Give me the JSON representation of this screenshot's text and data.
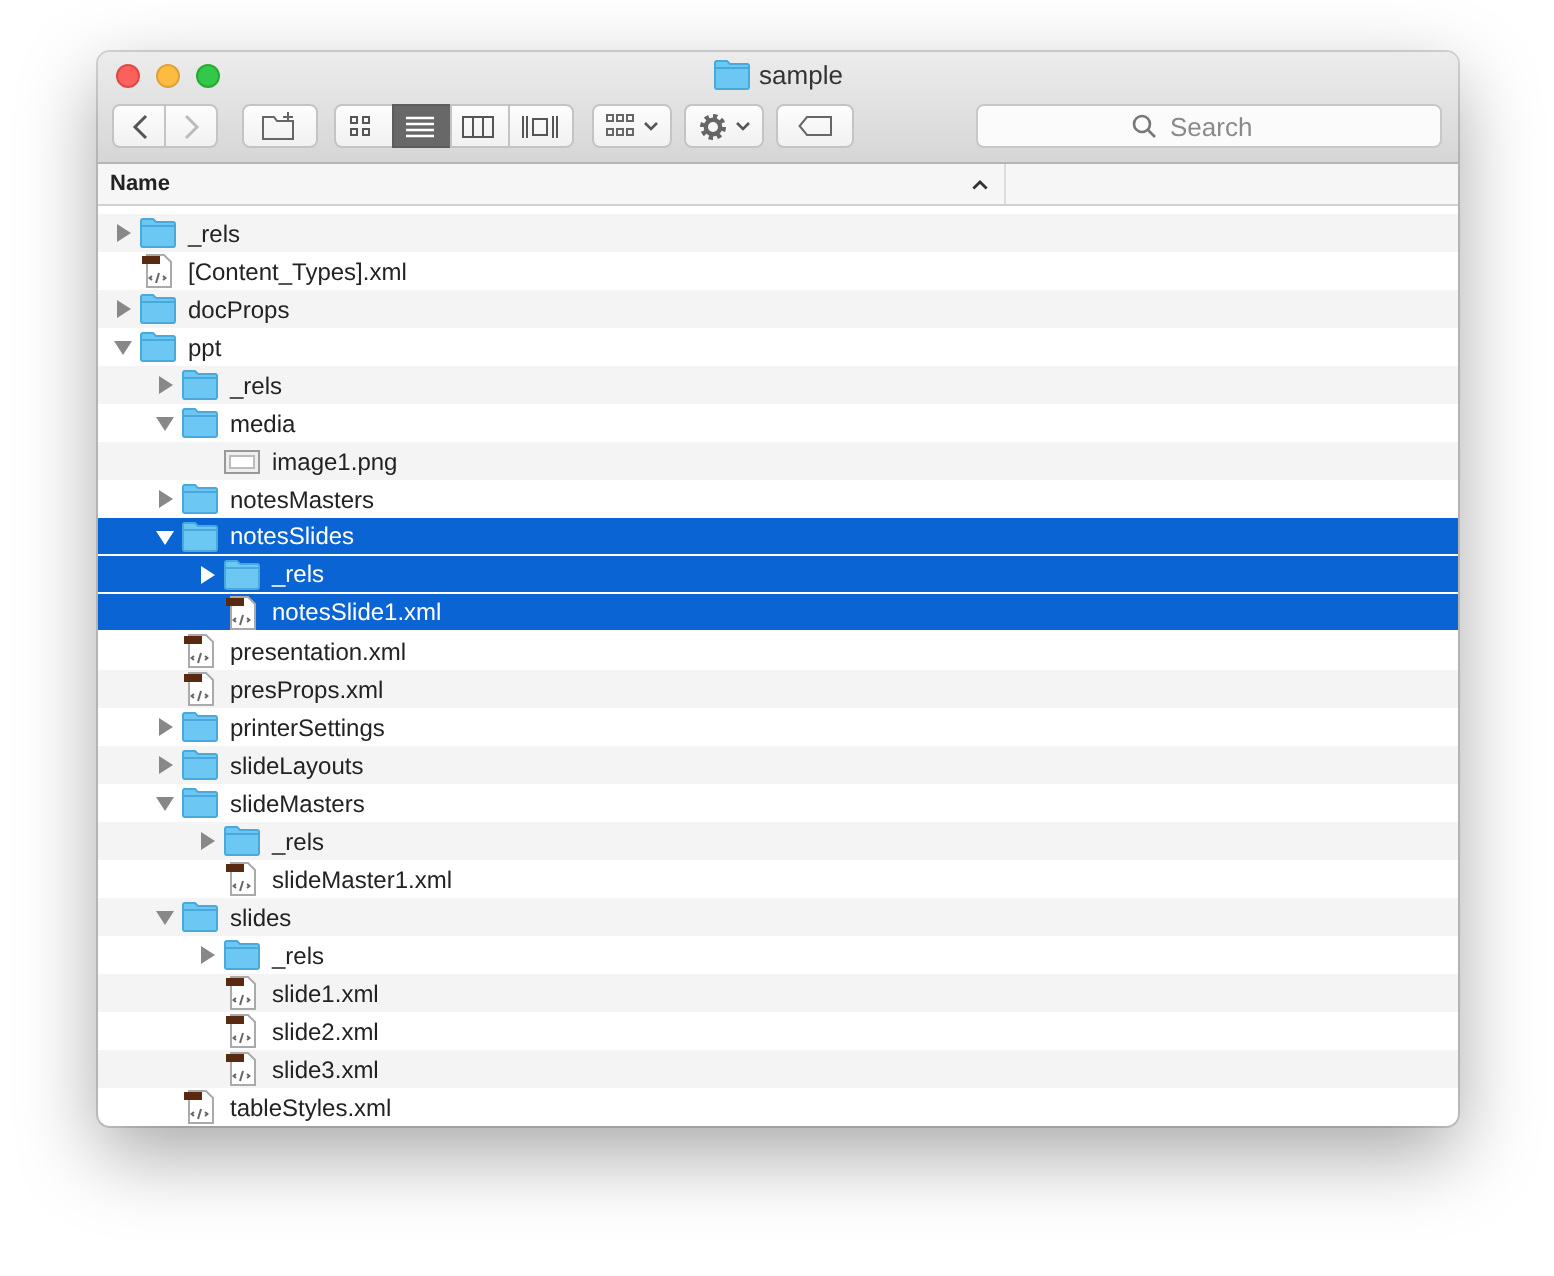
{
  "window": {
    "title": "sample"
  },
  "toolbar": {
    "view_buttons": [
      {
        "selected": false
      },
      {
        "selected": true
      },
      {
        "selected": false
      },
      {
        "selected": false
      }
    ],
    "search": {
      "placeholder": "Search"
    }
  },
  "columns": [
    {
      "label": "Name",
      "sorted": true
    }
  ],
  "tree": [
    {
      "name": "_rels",
      "kind": "folder",
      "expanded": false,
      "selected": false
    },
    {
      "name": "[Content_Types].xml",
      "kind": "xml",
      "selected": false
    },
    {
      "name": "docProps",
      "kind": "folder",
      "expanded": false,
      "selected": false
    },
    {
      "name": "ppt",
      "kind": "folder",
      "expanded": true,
      "selected": false,
      "children": [
        {
          "name": "_rels",
          "kind": "folder",
          "expanded": false,
          "selected": false
        },
        {
          "name": "media",
          "kind": "folder",
          "expanded": true,
          "selected": false,
          "children": [
            {
              "name": "image1.png",
              "kind": "image",
              "selected": false
            }
          ]
        },
        {
          "name": "notesMasters",
          "kind": "folder",
          "expanded": false,
          "selected": false
        },
        {
          "name": "notesSlides",
          "kind": "folder",
          "expanded": true,
          "selected": true,
          "children": [
            {
              "name": "_rels",
              "kind": "folder",
              "expanded": false,
              "selected": true
            },
            {
              "name": "notesSlide1.xml",
              "kind": "xml",
              "selected": true
            }
          ]
        },
        {
          "name": "presentation.xml",
          "kind": "xml",
          "selected": false
        },
        {
          "name": "presProps.xml",
          "kind": "xml",
          "selected": false
        },
        {
          "name": "printerSettings",
          "kind": "folder",
          "expanded": false,
          "selected": false
        },
        {
          "name": "slideLayouts",
          "kind": "folder",
          "expanded": false,
          "selected": false
        },
        {
          "name": "slideMasters",
          "kind": "folder",
          "expanded": true,
          "selected": false,
          "children": [
            {
              "name": "_rels",
              "kind": "folder",
              "expanded": false,
              "selected": false
            },
            {
              "name": "slideMaster1.xml",
              "kind": "xml",
              "selected": false
            }
          ]
        },
        {
          "name": "slides",
          "kind": "folder",
          "expanded": true,
          "selected": false,
          "children": [
            {
              "name": "_rels",
              "kind": "folder",
              "expanded": false,
              "selected": false
            },
            {
              "name": "slide1.xml",
              "kind": "xml",
              "selected": false
            },
            {
              "name": "slide2.xml",
              "kind": "xml",
              "selected": false
            },
            {
              "name": "slide3.xml",
              "kind": "xml",
              "selected": false
            }
          ]
        },
        {
          "name": "tableStyles.xml",
          "kind": "xml",
          "selected": false
        }
      ]
    }
  ]
}
